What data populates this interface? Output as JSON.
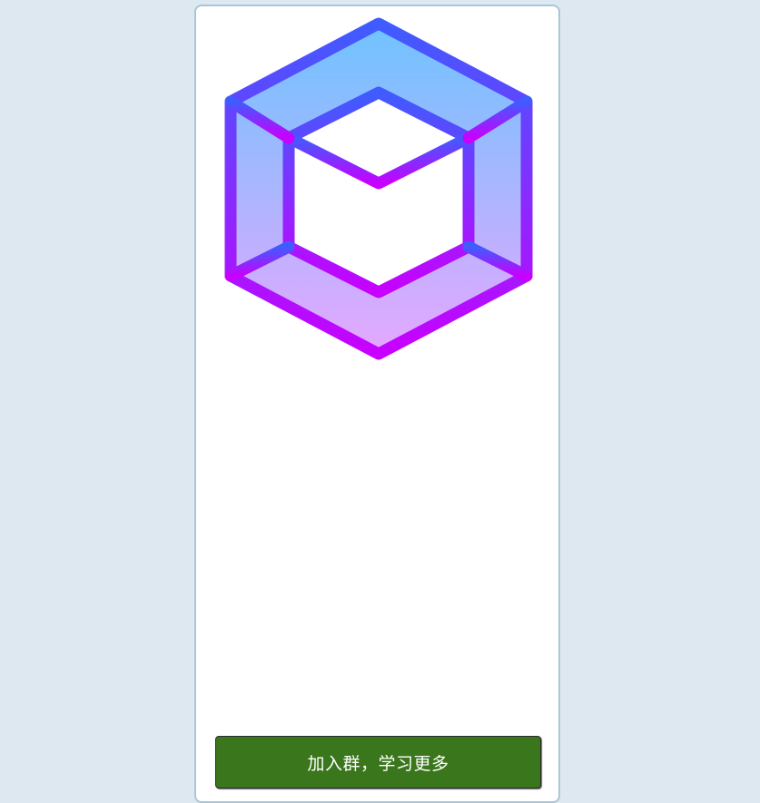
{
  "logo": {
    "icon": "webpack-cube-icon",
    "gradient_top": "#6fc3ff",
    "gradient_bottom": "#e5a8ff",
    "stroke_top": "#3f5cff",
    "stroke_bottom": "#c800ff"
  },
  "cta": {
    "label": "加入群，学习更多",
    "color": "#3a761c"
  }
}
